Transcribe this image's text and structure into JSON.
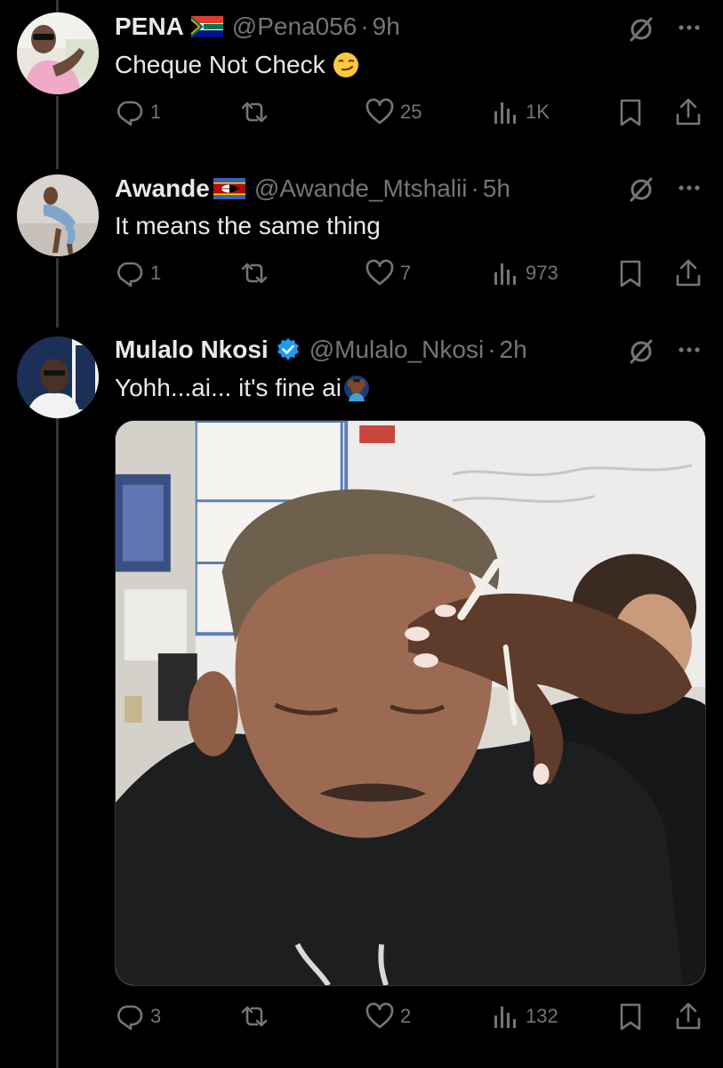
{
  "tweets": [
    {
      "name": "PENA",
      "flag": "south-africa-flag",
      "handle": "@Pena056",
      "time": "9h",
      "text": "Cheque Not Check",
      "emoji": "smirking-face-emoji",
      "stats": {
        "replies": "1",
        "retweets": "",
        "likes": "25",
        "views": "1K"
      }
    },
    {
      "name": "Awande",
      "flag": "eswatini-flag",
      "handle": "@Awande_Mtshalii",
      "time": "5h",
      "text": "It means the same thing",
      "stats": {
        "replies": "1",
        "retweets": "",
        "likes": "7",
        "views": "973"
      }
    },
    {
      "name": "Mulalo Nkosi",
      "verified": true,
      "handle": "@Mulalo_Nkosi",
      "time": "2h",
      "text": "Yohh...ai... it's fine ai",
      "emoji": "person-facepalming-emoji",
      "media": "meme photo of man with hand on forehead",
      "stats": {
        "replies": "3",
        "retweets": "",
        "likes": "2",
        "views": "132"
      }
    }
  ],
  "separator": "·",
  "colors": {
    "background": "#000000",
    "text_primary": "#e7e9ea",
    "text_secondary": "#71767b",
    "verified_blue": "#1d9bf0",
    "thread_line": "#333639"
  }
}
